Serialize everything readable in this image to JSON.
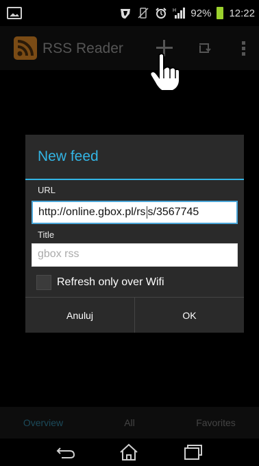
{
  "status_bar": {
    "battery_percent": "92%",
    "time": "12:22",
    "colors": {
      "battery": "#9bd12d"
    }
  },
  "action_bar": {
    "title": "RSS Reader",
    "icons": [
      "rss-logo-icon",
      "add-icon",
      "refresh-icon",
      "overflow-menu-icon"
    ]
  },
  "dialog": {
    "title": "New feed",
    "url_label": "URL",
    "url_value_before_caret": "http://online.gbox.pl/rs",
    "url_value_after_caret": "s/3567745",
    "title_label": "Title",
    "title_placeholder": "gbox rss",
    "checkbox_label": "Refresh only over Wifi",
    "checkbox_checked": false,
    "cancel_label": "Anuluj",
    "ok_label": "OK",
    "colors": {
      "accent": "#33b5e5"
    }
  },
  "tabs": [
    {
      "label": "Overview",
      "selected": true
    },
    {
      "label": "All",
      "selected": false
    },
    {
      "label": "Favorites",
      "selected": false
    }
  ],
  "nav_bar": {
    "icons": [
      "back-icon",
      "home-icon",
      "recent-apps-icon"
    ]
  }
}
